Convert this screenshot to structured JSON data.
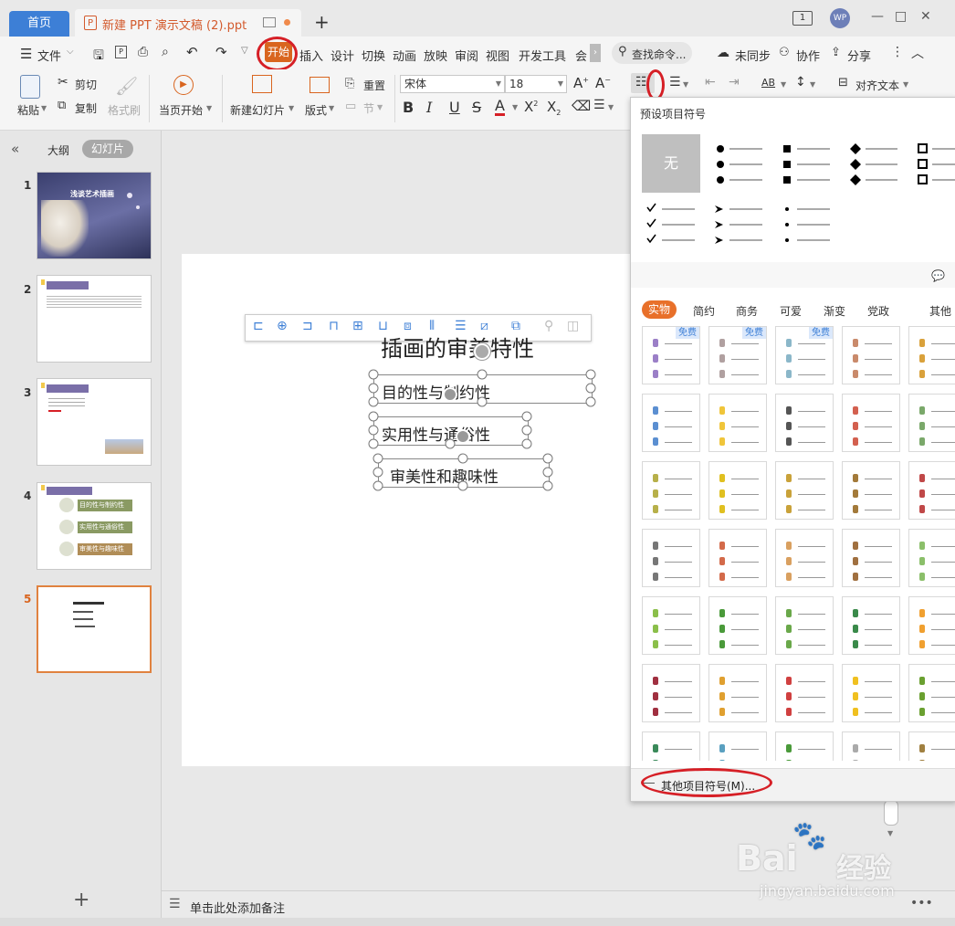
{
  "tabs": {
    "home": "首页",
    "document": "新建 PPT 演示文稿 (2).ppt",
    "add": "+"
  },
  "window": {
    "badge": "1",
    "user": "WP",
    "minimize": "—",
    "maximize": "□",
    "close": "✕"
  },
  "menu": {
    "file": "文件",
    "items": [
      "开始",
      "插入",
      "设计",
      "切换",
      "动画",
      "放映",
      "审阅",
      "视图",
      "开发工具",
      "会"
    ],
    "search": "查找命令...",
    "sync": "未同步",
    "collab": "协作",
    "share": "分享"
  },
  "ribbon": {
    "paste": "粘贴",
    "cut": "剪切",
    "copy": "复制",
    "format_painter": "格式刷",
    "play_current": "当页开始",
    "new_slide": "新建幻灯片",
    "layout": "版式",
    "reset": "重置",
    "section": "节",
    "font_name": "宋体",
    "font_size": "18",
    "align_text": "对齐文本"
  },
  "leftpanel": {
    "outline_tab": "大纲",
    "slides_tab": "幻灯片",
    "slide_numbers": [
      "1",
      "2",
      "3",
      "4",
      "5"
    ],
    "thumb1_title": "浅谈艺术插画",
    "thumb4_items": [
      "目的性与制约性",
      "实用性与通俗性",
      "审美性与趣味性"
    ],
    "add": "+"
  },
  "slide": {
    "title": "插画的审美特性",
    "boxes": [
      "目的性与制约性",
      "实用性与通俗性",
      "审美性和趣味性"
    ]
  },
  "notes": {
    "placeholder": "单击此处添加备注"
  },
  "bullet_panel": {
    "header": "预设项目符号",
    "none_label": "无",
    "preset_symbols": [
      "●",
      "■",
      "◆",
      "□",
      "✓",
      "➢",
      "•"
    ],
    "free_badge": "免费",
    "categories": [
      "实物",
      "简约",
      "商务",
      "可爱",
      "渐变",
      "党政",
      "其他"
    ],
    "footer": "其他项目符号(M)..."
  },
  "watermark": {
    "brand": "Bai",
    "brand2": "经验",
    "url": "jingyan.baidu.com"
  },
  "colors": {
    "accent": "#d9651f",
    "home_tab": "#3d7fd6",
    "annotation": "#d61f26"
  }
}
